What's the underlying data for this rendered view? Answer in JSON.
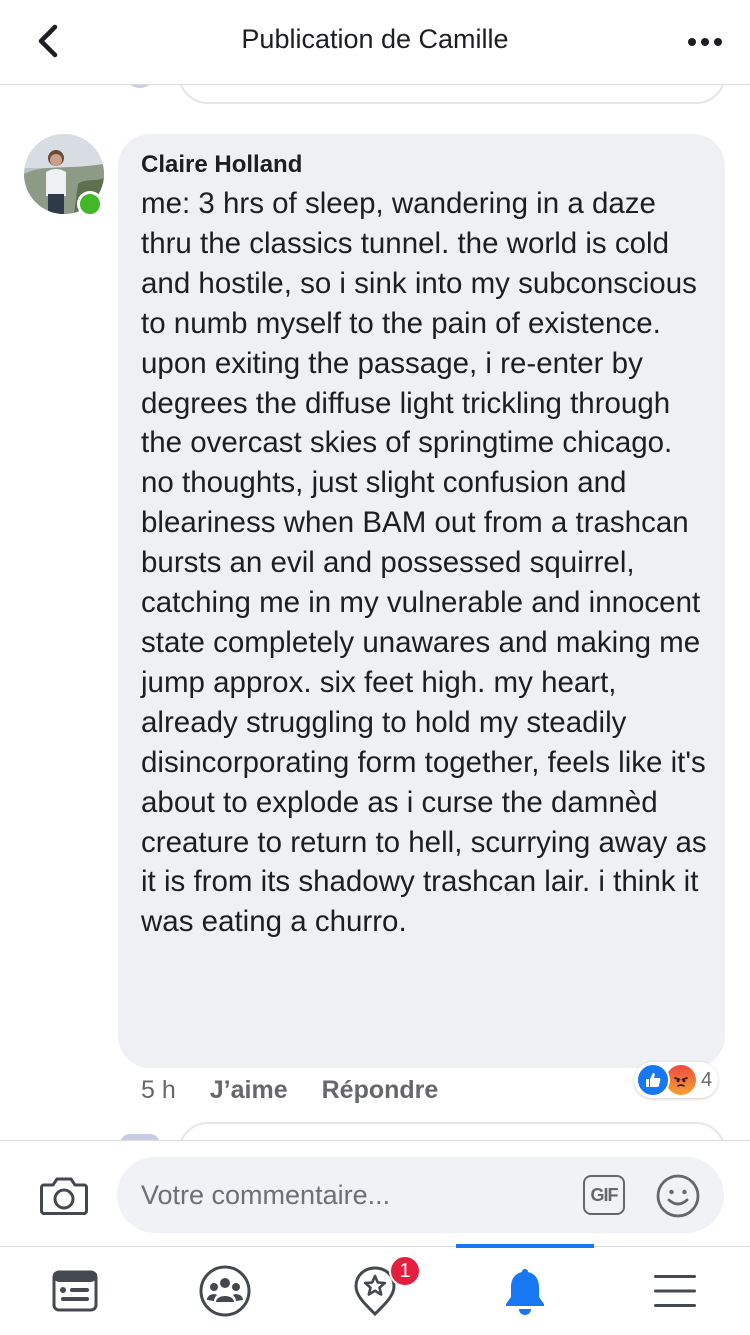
{
  "header": {
    "title": "Publication de Camille",
    "back_icon": "chevron-left-icon",
    "more_icon": "more-horizontal-icon"
  },
  "comment": {
    "author": "Claire Holland",
    "online": true,
    "text": "me: 3 hrs of sleep, wandering in a daze thru the classics tunnel. the world is cold and hostile, so i sink into my subconscious to numb myself to the pain of existence.\nupon exiting the passage, i re-enter by degrees the diffuse light trickling through the overcast skies of springtime chicago. no thoughts, just slight confusion and bleariness when BAM out from a trashcan bursts an evil and possessed squirrel, catching me in my vulnerable and innocent state completely unawares and making me jump approx. six feet high. my heart, already struggling to hold my steadily disincorporating form together, feels like it's about to explode as i curse the damnèd creature to return to hell, scurrying away as it is from its shadowy trashcan lair. i think it was eating a churro.",
    "time": "5 h",
    "like_label": "J’aime",
    "reply_label": "Répondre",
    "reactions": {
      "types": [
        "like",
        "angry"
      ],
      "count": "4"
    }
  },
  "composer": {
    "placeholder": "Votre commentaire...",
    "gif_label": "GIF",
    "camera_icon": "camera-icon",
    "emoji_icon": "smiley-icon"
  },
  "tabbar": {
    "tabs": [
      {
        "name": "news-feed",
        "icon": "news-feed-icon",
        "active": false
      },
      {
        "name": "groups",
        "icon": "groups-icon",
        "active": false
      },
      {
        "name": "marketplace",
        "icon": "marketplace-icon",
        "active": false,
        "badge": "1"
      },
      {
        "name": "notifications",
        "icon": "bell-icon",
        "active": true
      },
      {
        "name": "menu",
        "icon": "hamburger-menu-icon",
        "active": false
      }
    ]
  },
  "colors": {
    "accent": "#1877f2",
    "bubble": "#eff0f3",
    "secondary_text": "#65676b",
    "online": "#42b72a",
    "badge": "#e41e3f"
  }
}
